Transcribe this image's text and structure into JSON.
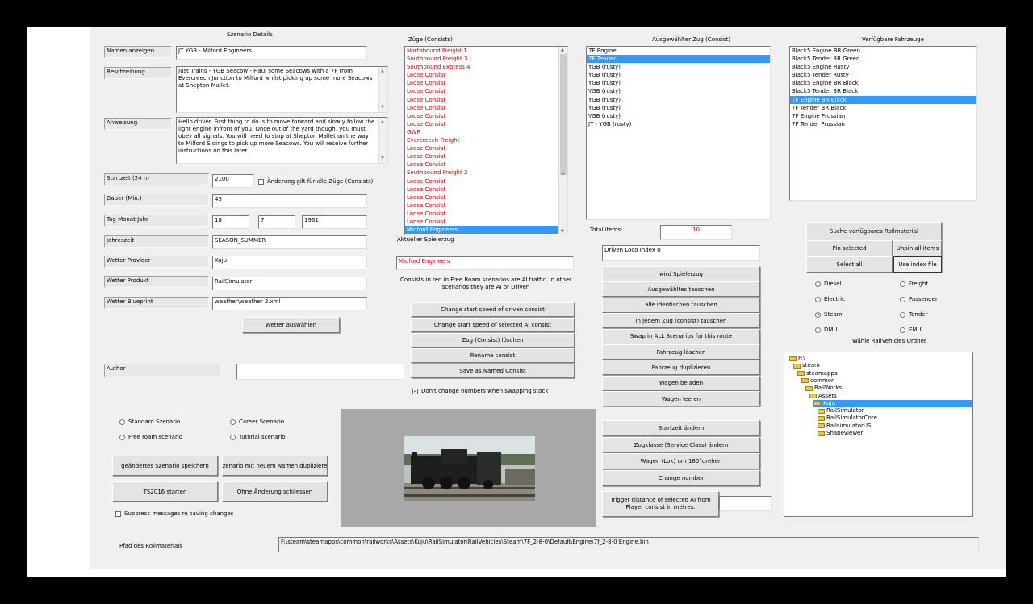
{
  "details": {
    "title": "Szenario Details",
    "name_label": "Namen anzeigen",
    "name_value": "JT YGB - Milford Engineers",
    "desc_label": "Beschreibung",
    "desc_value": "Just Trains - YGB Seacow - Haul some Seacows with a 7F from Evercreech Junction to Milford whilst picking up some more Seacows at Shepton Mallet.",
    "instr_label": "Anweisung",
    "instr_value": "Hello driver. First thing to do is to move forward and slowly follow the light engine infront of you. Once out of the yard though, you must obey all signals. You will need to stop at Shepton Mallet on the way to Milford Sidings to pick up more Seacows. You will receive further instructions on this later.",
    "start_label": "Startzeit (24 h)",
    "start_value": "2100",
    "all_trains_check": "Änderung gilt für alle Züge (Consists)",
    "duration_label": "Dauer (Min.)",
    "duration_value": "45",
    "date_label": "Tag Monat Jahr",
    "day": "18",
    "month": "7",
    "year": "1961",
    "season_label": "Jahreszeit",
    "season_value": "SEASON_SUMMER",
    "wprov_label": "Wetter Provider",
    "wprov_value": "Kuju",
    "wprod_label": "Wetter Produkt",
    "wprod_value": "RailSimulator",
    "wbp_label": "Wetter Blueprint",
    "wbp_value": "weather\\weather 2.xml",
    "weather_btn": "Wetter auswählen",
    "author_label": "Author",
    "author_value": ""
  },
  "scenario_types": {
    "standard": "Standard Szenario",
    "career": "Career Scenario",
    "free": "Free roam scenario",
    "tutorial": "Tutorial scenario"
  },
  "actions": {
    "save": "geändertes Szenario speichern",
    "dup": "Szenario mit neuem Namen duplizieren",
    "start": "TS2016 starten",
    "close": "Ohne Änderung schliessen",
    "suppress": "Suppress messages re saving changes"
  },
  "path": {
    "label": "Pfad des Rollmaterials",
    "value": "F:\\steam\\steamapps\\common\\railworks\\Assets\\Kuju\\RailSimulator\\RailVehicles\\Steam\\7F_2-8-0\\Default\\Engine\\7f_2-8-0 Engine.bin"
  },
  "consists": {
    "title": "Züge (Consists)",
    "items": [
      {
        "t": "Northbound Freight 1",
        "red": true
      },
      {
        "t": "Southbound Freight 3",
        "red": true
      },
      {
        "t": "Southbound Express 4",
        "red": true
      },
      {
        "t": "Loose Consist",
        "red": true
      },
      {
        "t": "Loose Consist",
        "red": true
      },
      {
        "t": "Loose Consist",
        "red": true
      },
      {
        "t": "Loose Consist",
        "red": true
      },
      {
        "t": "Loose Consist",
        "red": true
      },
      {
        "t": "Loose Consist",
        "red": true
      },
      {
        "t": "Loose Consist",
        "red": true
      },
      {
        "t": "GWR",
        "red": true
      },
      {
        "t": "Evercreech Freight",
        "red": true
      },
      {
        "t": "Loose Consist",
        "red": true
      },
      {
        "t": "Loose Consist",
        "red": true
      },
      {
        "t": "Loose Consist",
        "red": true
      },
      {
        "t": "Southbound Freight 2",
        "red": true
      },
      {
        "t": "Loose Consist",
        "red": true
      },
      {
        "t": "Loose Consist",
        "red": true
      },
      {
        "t": "Loose Consist",
        "red": true
      },
      {
        "t": "Loose Consist",
        "red": true
      },
      {
        "t": "Loose Consist",
        "red": true
      },
      {
        "t": "Loose Consist",
        "red": true
      },
      {
        "t": "Midford Engineers",
        "red": false,
        "sel": true
      }
    ],
    "player_label": "Aktueller Spielerzug",
    "player_value": "Midford Engineers",
    "note": "Consists in red in Free Roam scenarios are AI traffic. In other scenarios they are AI or Driven",
    "btn_speed_driven": "Change start speed of driven consist",
    "btn_speed_ai": "Change start speed of selected AI consist",
    "btn_delete": "Zug (Consist) löschen",
    "btn_rename": "Rename consist",
    "btn_save_named": "Save as Named Consist",
    "no_change_numbers": "Don't change numbers when swapping stock"
  },
  "selected_train": {
    "title": "Ausgewählter Zug (Consist)",
    "items": [
      {
        "t": "7F Engine"
      },
      {
        "t": "7F Tender",
        "sel": true
      },
      {
        "t": "YGB (rusty)"
      },
      {
        "t": "YGB (rusty)"
      },
      {
        "t": "YGB (rusty)"
      },
      {
        "t": "YGB (rusty)"
      },
      {
        "t": "YGB (rusty)"
      },
      {
        "t": "YGB (rusty)"
      },
      {
        "t": "YGB (rusty)"
      },
      {
        "t": "JT - YGB (rusty)"
      }
    ],
    "total_label": "Total items:",
    "total_value": "10",
    "driven_loco": "Driven Loco Index 0",
    "btns": [
      "wird Spielerzug",
      "Ausgewähltes tauschen",
      "alle identischen tauschen",
      "in jedem Zug (consist) tauschen",
      "Swap in ALL Scenarios for this route",
      "Fahrzeug löschen",
      "Fahrzeug duplizieren",
      "Wagen beladen",
      "Wagen leeren"
    ],
    "btns2": [
      "Startzeit ändern",
      "Zugklasse (Service Class) ändern",
      "Wagen (Lok) um 180°drehen",
      "Change number"
    ],
    "trigger_btn": "Trigger distance of selected AI from Player consist in metres.",
    "trigger_value": ""
  },
  "vehicles": {
    "title": "Verfügbare Fahrzeuge",
    "items": [
      {
        "t": "Black5 Engine BR Green"
      },
      {
        "t": "Black5 Tender BR Green"
      },
      {
        "t": "Black5 Engine Rusty"
      },
      {
        "t": "Black5 Tender Rusty"
      },
      {
        "t": "Black5 Engine BR Black"
      },
      {
        "t": "Black5 Tender BR Black"
      },
      {
        "t": "7F Engine BR Black",
        "sel": true
      },
      {
        "t": "7F Tender BR Black"
      },
      {
        "t": "7F Engine Prussian"
      },
      {
        "t": "7F Tender Prussian"
      }
    ],
    "search_btn": "Suche verfügbares Rollmaterial",
    "pin_btn": "Pin selected",
    "unpin_btn": "Unpin all items",
    "selall_btn": "Select all",
    "useidx_btn": "Use index file",
    "types": {
      "diesel": "Diesel",
      "freight": "Freight",
      "electric": "Electric",
      "passenger": "Passenger",
      "steam": "Steam",
      "tender": "Tender",
      "dmu": "DMU",
      "emu": "EMU"
    },
    "folder_title": "Wähle RailVehicles Ordner",
    "tree": [
      {
        "t": "F:\\",
        "lvl": 0
      },
      {
        "t": "steam",
        "lvl": 1
      },
      {
        "t": "steamapps",
        "lvl": 2
      },
      {
        "t": "common",
        "lvl": 3
      },
      {
        "t": "RailWorks",
        "lvl": 4
      },
      {
        "t": "Assets",
        "lvl": 5
      },
      {
        "t": "Kuju",
        "lvl": 6,
        "sel": true
      },
      {
        "t": "RailSimulator",
        "lvl": 7
      },
      {
        "t": "RailSimulatorCore",
        "lvl": 7
      },
      {
        "t": "RailsimulatorUS",
        "lvl": 7
      },
      {
        "t": "Shapeviewer",
        "lvl": 7
      }
    ]
  }
}
